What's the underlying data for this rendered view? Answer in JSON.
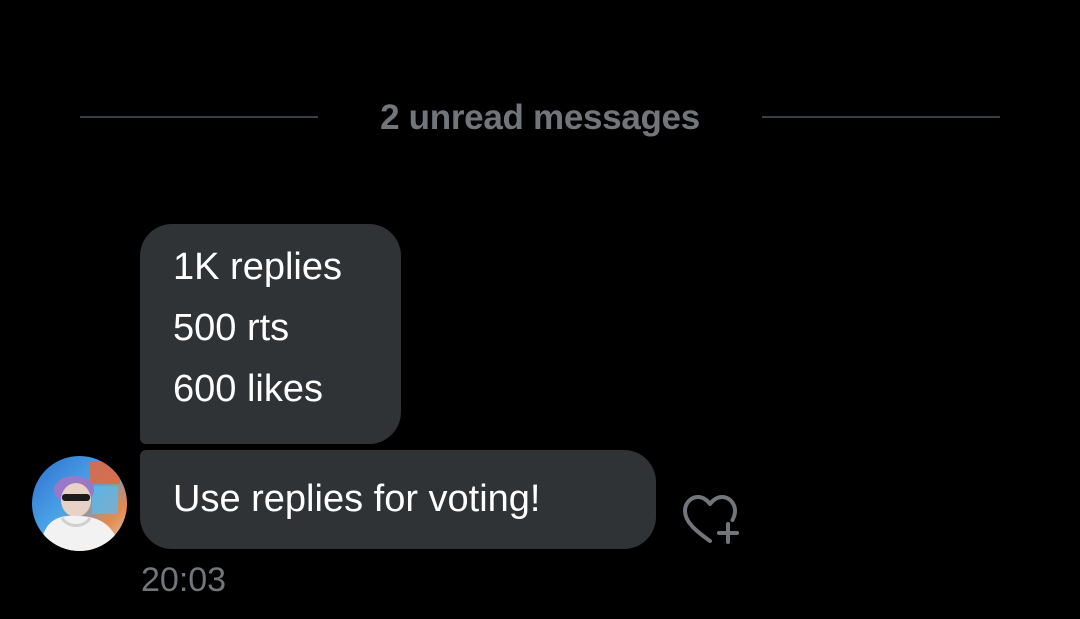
{
  "conversation": {
    "divider": {
      "label": "2 unread messages"
    },
    "messages": [
      {
        "lines": [
          "1K replies",
          "500 rts",
          "600 likes"
        ]
      },
      {
        "text": "Use replies for voting!"
      }
    ],
    "timestamp": "20:03"
  },
  "icons": {
    "reaction": "heart-plus-icon",
    "avatar": "user-avatar"
  },
  "colors": {
    "background": "#000000",
    "bubble": "#2f3336",
    "muted_text": "#71767b",
    "divider": "#3a3d41"
  }
}
